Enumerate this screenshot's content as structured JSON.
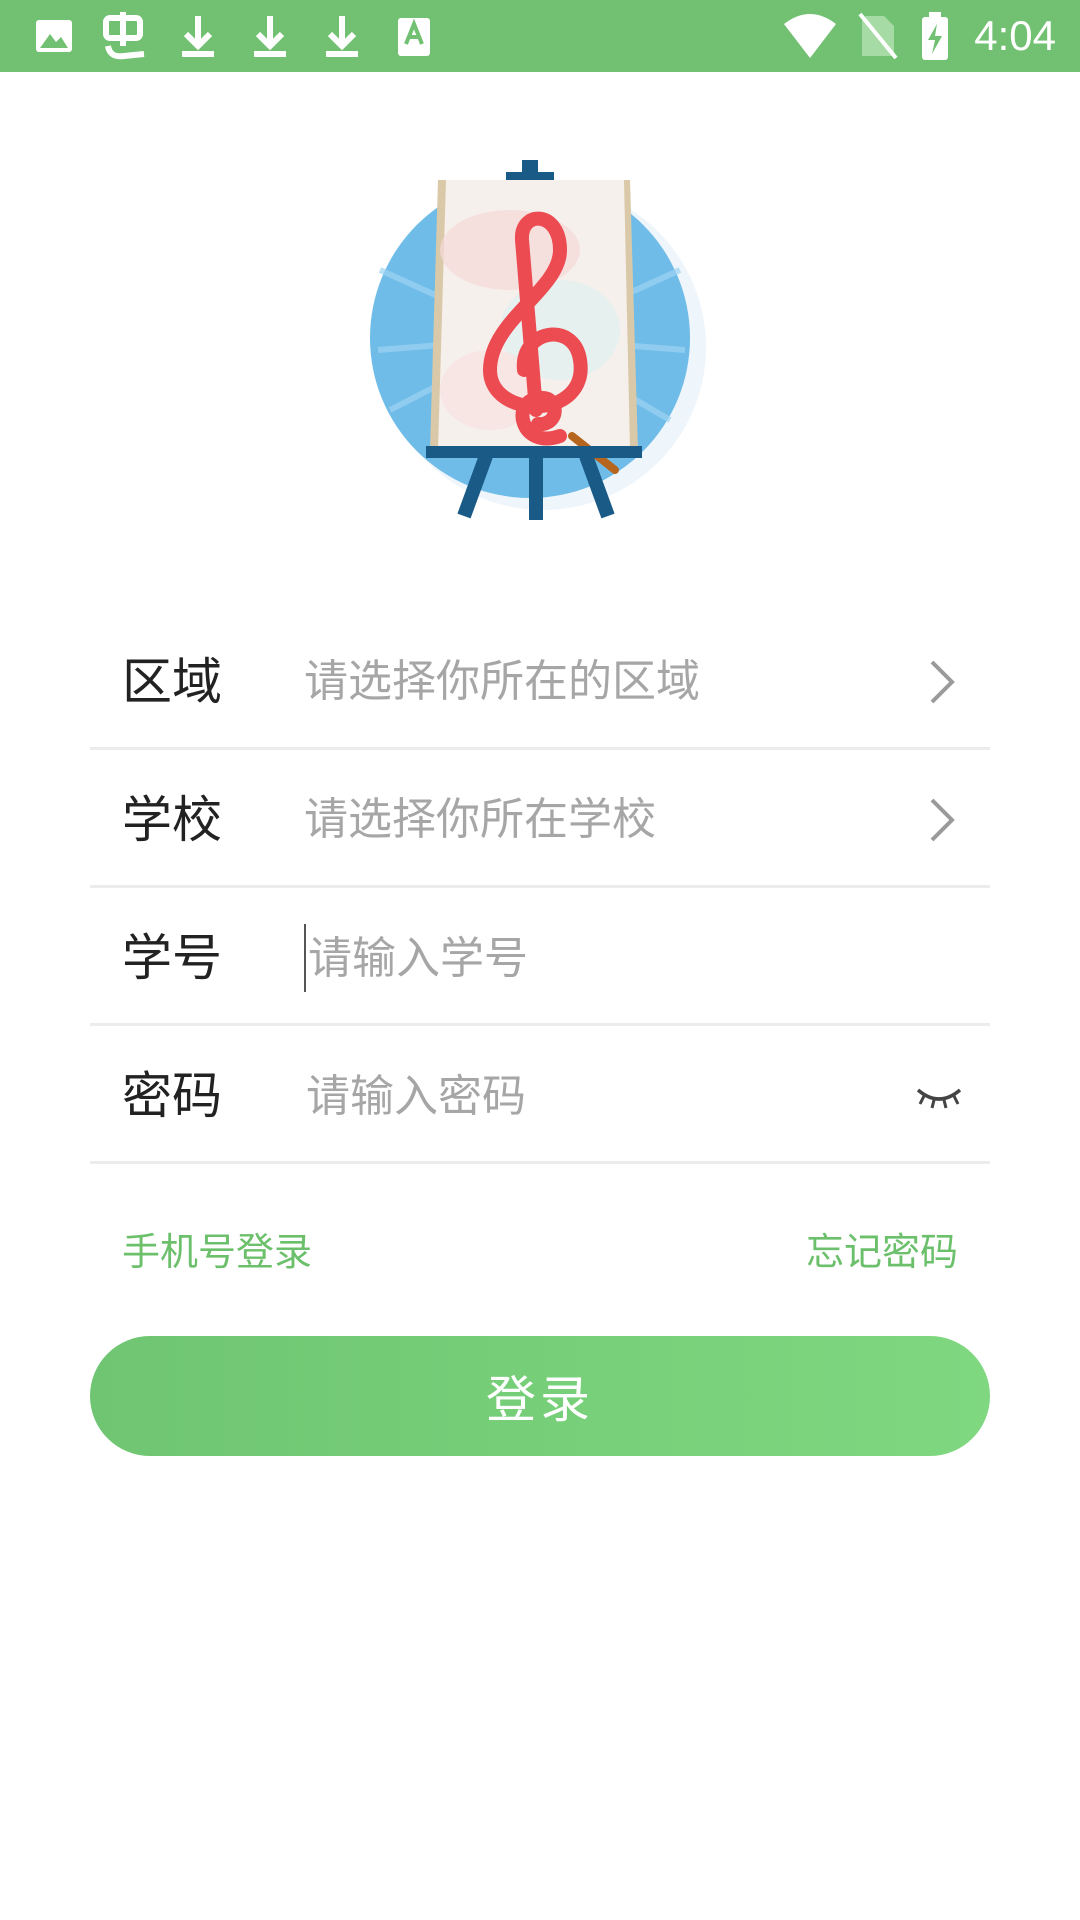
{
  "status_bar": {
    "time": "4:04",
    "left_icons": [
      "image-icon",
      "app-notification-icon",
      "download-icon",
      "download-icon",
      "download-icon",
      "text-icon"
    ],
    "right_icons": [
      "wifi-icon",
      "no-sim-icon",
      "battery-charging-icon"
    ]
  },
  "logo": {
    "icon": "treble-clef-easel-icon"
  },
  "form": {
    "region": {
      "label": "区域",
      "placeholder": "请选择你所在的区域"
    },
    "school": {
      "label": "学校",
      "placeholder": "请选择你所在学校"
    },
    "student_id": {
      "label": "学号",
      "placeholder": "请输入学号"
    },
    "password": {
      "label": "密码",
      "placeholder": "请输入密码"
    }
  },
  "links": {
    "phone_login": "手机号登录",
    "forgot_password": "忘记密码"
  },
  "login_button": "登录",
  "colors": {
    "accent": "#72c172",
    "link": "#6cc06c",
    "button_start": "#6fc572",
    "button_end": "#7fd880"
  }
}
